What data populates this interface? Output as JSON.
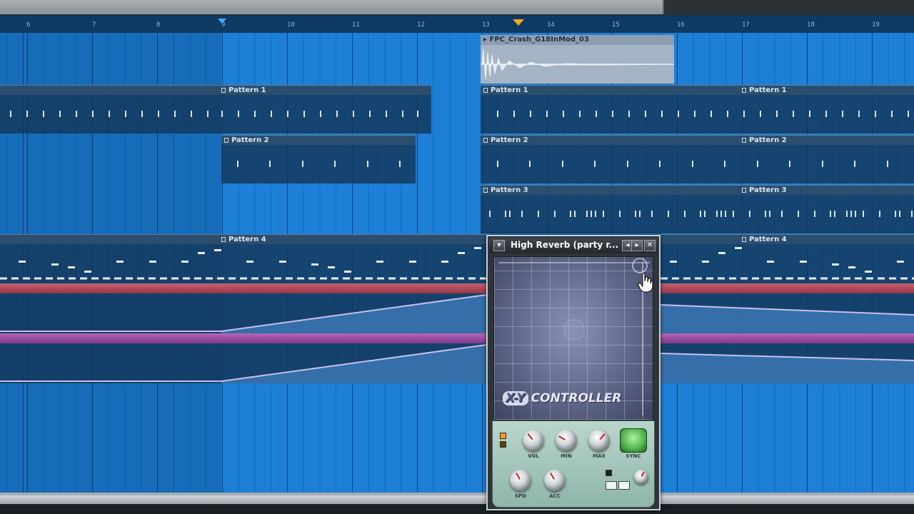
{
  "ruler": {
    "bars": [
      "6",
      "7",
      "8",
      "9",
      "10",
      "11",
      "12",
      "13",
      "14",
      "15",
      "16",
      "17",
      "18",
      "19"
    ]
  },
  "audio_clip": {
    "label": "FPC_Crash_G18InMod_03"
  },
  "tracks": {
    "track1": [
      "Pattern 1",
      "Pattern 1",
      "Pattern 1"
    ],
    "track2": [
      "Pattern 2",
      "Pattern 2",
      "Pattern 2"
    ],
    "track3": [
      "Pattern 3",
      "Pattern 3"
    ],
    "track4": [
      "Pattern 4",
      "Pattern 4"
    ]
  },
  "plugin": {
    "title": "High Reverb (party r...",
    "close_glyph": "✕",
    "menu_glyph": "▾",
    "prev_glyph": "◂",
    "next_glyph": "▸",
    "logo_xy": "X-Y",
    "logo_text": "CONTROLLER",
    "knob_labels": [
      "VOL",
      "MIN",
      "MAX",
      "SPD",
      "ACC"
    ],
    "button_label": "SYNC",
    "colors": {
      "accent": "#4fb24a",
      "pad": "#6b7394"
    }
  }
}
